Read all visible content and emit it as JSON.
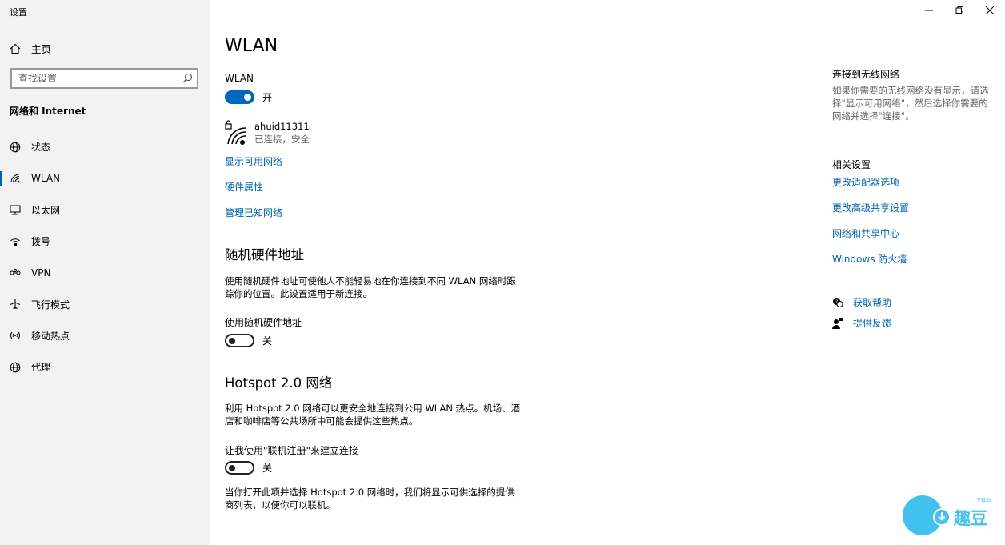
{
  "app": {
    "title": "设置"
  },
  "window_controls": {
    "minimize": "—",
    "maximize": "❐",
    "close": "✕"
  },
  "sidebar": {
    "home_label": "主页",
    "search_placeholder": "查找设置",
    "section_title": "网络和 Internet",
    "items": [
      {
        "label": "状态",
        "icon": "globe-status-icon"
      },
      {
        "label": "WLAN",
        "icon": "wifi-icon",
        "active": true
      },
      {
        "label": "以太网",
        "icon": "ethernet-icon"
      },
      {
        "label": "拨号",
        "icon": "dialup-icon"
      },
      {
        "label": "VPN",
        "icon": "vpn-icon"
      },
      {
        "label": "飞行模式",
        "icon": "airplane-icon"
      },
      {
        "label": "移动热点",
        "icon": "hotspot-icon"
      },
      {
        "label": "代理",
        "icon": "proxy-globe-icon"
      }
    ]
  },
  "main": {
    "title": "WLAN",
    "wlan_label": "WLAN",
    "wlan_state": "开",
    "network": {
      "name": "ahuid11311",
      "status": "已连接，安全"
    },
    "links": [
      "显示可用网络",
      "硬件属性",
      "管理已知网络"
    ],
    "random_mac": {
      "heading": "随机硬件地址",
      "description": "使用随机硬件地址可使他人不能轻易地在你连接到不同 WLAN 网络时跟踪你的位置。此设置适用于新连接。",
      "toggle_label": "使用随机硬件地址",
      "toggle_state": "关"
    },
    "hotspot": {
      "heading": "Hotspot 2.0 网络",
      "description": "利用 Hotspot 2.0 网络可以更安全地连接到公用 WLAN 热点。机场、酒店和咖啡店等公共场所中可能会提供这些热点。",
      "toggle_label": "让我使用\"联机注册\"来建立连接",
      "toggle_state": "关",
      "note": "当你打开此项并选择 Hotspot 2.0 网络时，我们将显示可供选择的提供商列表，以便你可以联机。"
    }
  },
  "right": {
    "connect_heading": "连接到无线网络",
    "connect_text": "如果你需要的无线网络没有显示，请选择\"显示可用网络\"，然后选择你需要的网络并选择\"连接\"。",
    "related_heading": "相关设置",
    "related_links": [
      "更改适配器选项",
      "更改高级共享设置",
      "网络和共享中心",
      "Windows 防火墙"
    ],
    "help_label": "获取帮助",
    "feedback_label": "提供反馈"
  },
  "watermark": {
    "brand": "趣豆",
    "small": "下载站"
  },
  "colors": {
    "accent": "#0063b1",
    "toggle_on": "#0067c0",
    "sidebar_bg": "#f2f2f2",
    "watermark": "#41c2ee"
  }
}
